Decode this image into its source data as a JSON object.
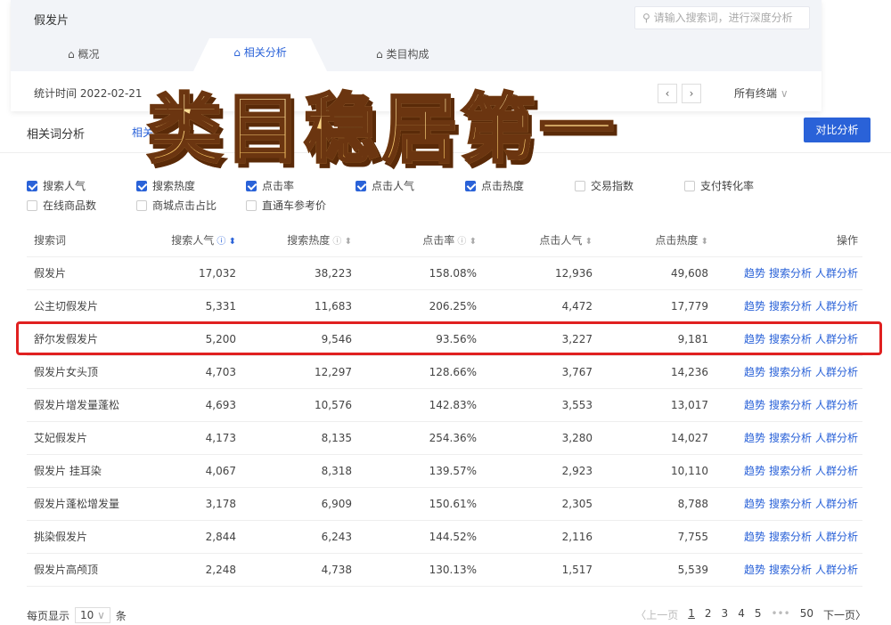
{
  "header": {
    "title": "假发片",
    "search_placeholder": "请输入搜索词，进行深度分析"
  },
  "tabs": [
    {
      "label": "概况"
    },
    {
      "label": "相关分析",
      "active": true
    },
    {
      "label": "类目构成"
    }
  ],
  "stat": {
    "label": "统计时间 2022-02-21",
    "terminal": "所有终端"
  },
  "section": {
    "title": "相关词分析",
    "subtab": "相关",
    "compare_button": "对比分析"
  },
  "metrics": [
    {
      "label": "搜索人气",
      "checked": true
    },
    {
      "label": "搜索热度",
      "checked": true
    },
    {
      "label": "点击率",
      "checked": true
    },
    {
      "label": "点击人气",
      "checked": true
    },
    {
      "label": "点击热度",
      "checked": true
    },
    {
      "label": "交易指数",
      "checked": false
    },
    {
      "label": "支付转化率",
      "checked": false
    },
    {
      "label": "在线商品数",
      "checked": false
    },
    {
      "label": "商城点击占比",
      "checked": false
    },
    {
      "label": "直通车参考价",
      "checked": false
    }
  ],
  "table": {
    "headers": [
      "搜索词",
      "搜索人气",
      "搜索热度",
      "点击率",
      "点击人气",
      "点击热度",
      "操作"
    ],
    "actions": [
      "趋势",
      "搜索分析",
      "人群分析"
    ],
    "rows": [
      [
        "假发片",
        "17,032",
        "38,223",
        "158.08%",
        "12,936",
        "49,608"
      ],
      [
        "公主切假发片",
        "5,331",
        "11,683",
        "206.25%",
        "4,472",
        "17,779"
      ],
      [
        "舒尔发假发片",
        "5,200",
        "9,546",
        "93.56%",
        "3,227",
        "9,181"
      ],
      [
        "假发片女头顶",
        "4,703",
        "12,297",
        "128.66%",
        "3,767",
        "14,236"
      ],
      [
        "假发片增发量蓬松",
        "4,693",
        "10,576",
        "142.83%",
        "3,553",
        "13,017"
      ],
      [
        "艾妃假发片",
        "4,173",
        "8,135",
        "254.36%",
        "3,280",
        "14,027"
      ],
      [
        "假发片 挂耳染",
        "4,067",
        "8,318",
        "139.57%",
        "2,923",
        "10,110"
      ],
      [
        "假发片蓬松增发量",
        "3,178",
        "6,909",
        "150.61%",
        "2,305",
        "8,788"
      ],
      [
        "挑染假发片",
        "2,844",
        "6,243",
        "144.52%",
        "2,116",
        "7,755"
      ],
      [
        "假发片高颅顶",
        "2,248",
        "4,738",
        "130.13%",
        "1,517",
        "5,539"
      ]
    ]
  },
  "pagination": {
    "per_page_label": "每页显示",
    "per_page": "10",
    "unit": "条",
    "prev": "〈上一页",
    "pages": [
      "1",
      "2",
      "3",
      "4",
      "5"
    ],
    "ellipsis": "•••",
    "last": "50",
    "next": "下一页〉"
  },
  "overlay_text": "类目稳居第一",
  "colors": {
    "accent": "#2a62d8",
    "highlight": "#e02020"
  }
}
